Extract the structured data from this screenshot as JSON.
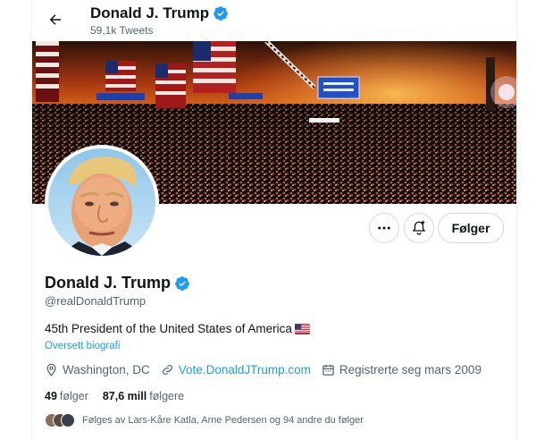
{
  "header": {
    "name": "Donald J. Trump",
    "tweet_count": "59,1k Tweets"
  },
  "profile": {
    "name": "Donald J. Trump",
    "handle": "@realDonaldTrump",
    "bio": "45th President of the United States of America",
    "bio_flag": "us-flag-emoji",
    "translate_label": "Oversett biografi",
    "location": "Washington, DC",
    "website": "Vote.DonaldJTrump.com",
    "joined": "Registrerte seg mars 2009"
  },
  "actions": {
    "more_icon": "more-dots-icon",
    "notify_icon": "notification-bell-plus-icon",
    "follow_label": "Følger"
  },
  "stats": {
    "following_count": "49",
    "following_label": "følger",
    "followers_count": "87,6 mill",
    "followers_label": "følgere"
  },
  "followed_by": {
    "text": "Følges av Lars-Kåre Katla, Arne Pedersen og 94 andre du følger"
  },
  "colors": {
    "accent": "#1d9bf0",
    "text": "#0f1419",
    "muted": "#536471",
    "border": "#cfd9de"
  }
}
